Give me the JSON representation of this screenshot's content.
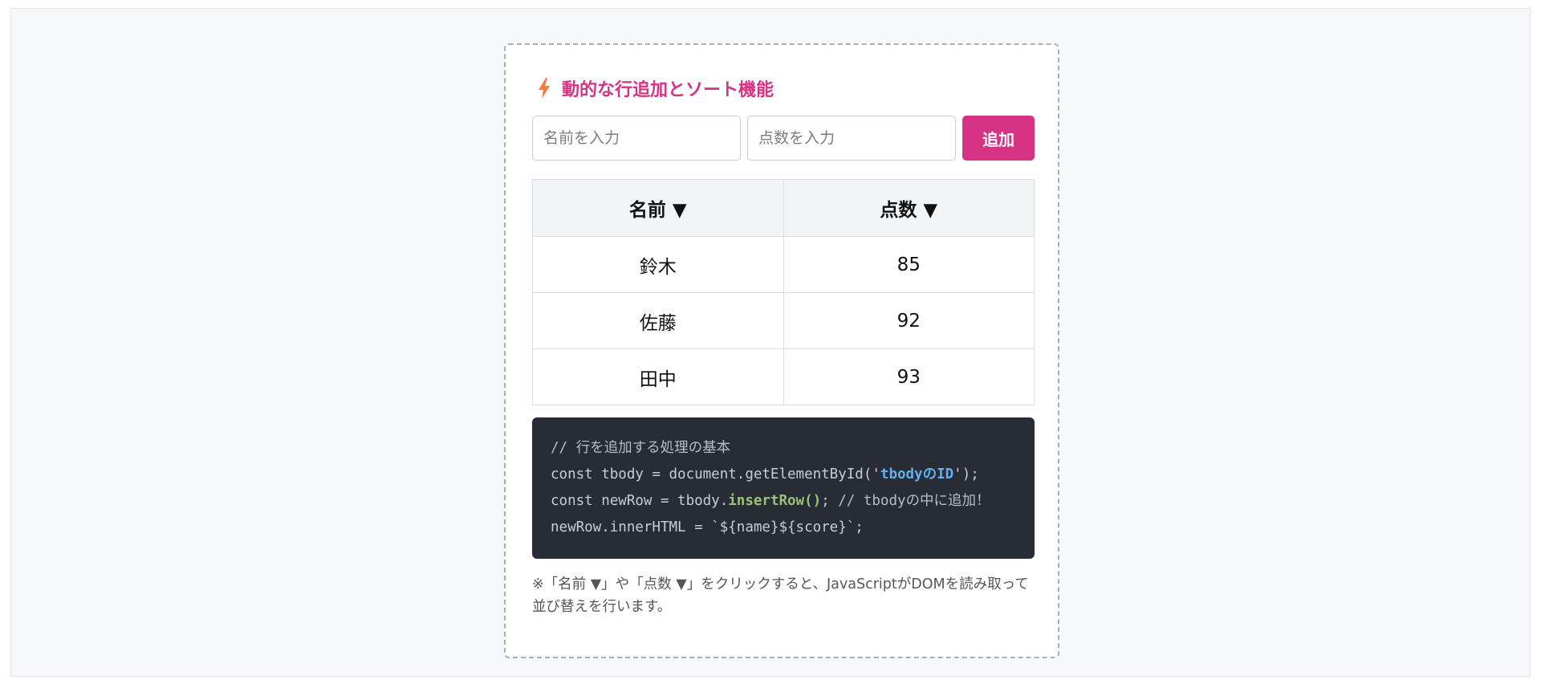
{
  "card": {
    "title": "動的な行追加とソート機能",
    "title_icon": "lightning-bolt-icon",
    "accent_color": "#d63384"
  },
  "form": {
    "name_placeholder": "名前を入力",
    "score_placeholder": "点数を入力",
    "name_value": "",
    "score_value": "",
    "add_label": "追加"
  },
  "table": {
    "headers": [
      "名前 ▼",
      "点数 ▼"
    ],
    "rows": [
      [
        "鈴木",
        "85"
      ],
      [
        "佐藤",
        "92"
      ],
      [
        "田中",
        "93"
      ]
    ]
  },
  "code": {
    "line1": "// 行を追加する処理の基本",
    "line2_prefix": "const tbody = document.getElementById('",
    "line2_str": "tbodyのID",
    "line2_suffix": "');",
    "line3_prefix": "const newRow = tbody.",
    "line3_fn": "insertRow()",
    "line3_mid": "; ",
    "line3_comment": "// tbodyの中に追加！",
    "line4": "newRow.innerHTML = `${name}${score}`;"
  },
  "note": "※「名前 ▼」や「点数 ▼」をクリックすると、JavaScriptがDOMを読み取って並び替えを行います。"
}
